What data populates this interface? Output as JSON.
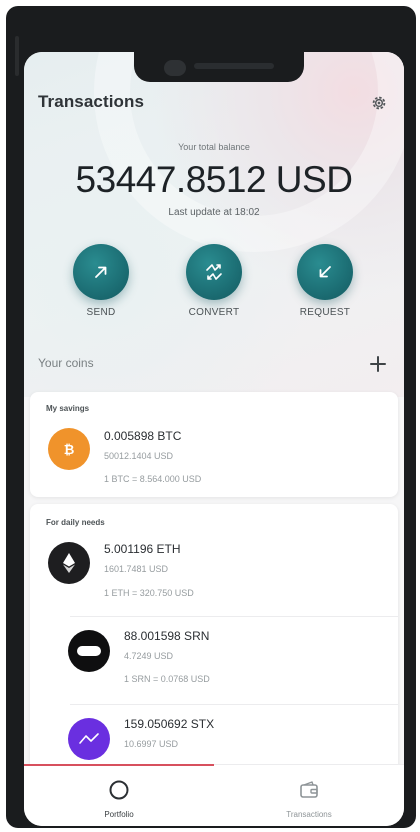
{
  "header": {
    "title": "Transactions",
    "settings_icon": "gear-icon"
  },
  "balance": {
    "caption": "Your total balance",
    "amount": "53447.8512 USD",
    "last_update": "Last update at 18:02"
  },
  "actions": [
    {
      "label": "SEND",
      "icon": "arrow-up-right-icon"
    },
    {
      "label": "CONVERT",
      "icon": "convert-arrows-icon"
    },
    {
      "label": "REQUEST",
      "icon": "arrow-down-left-icon"
    }
  ],
  "coins": {
    "header": "Your coins",
    "add_icon": "plus-icon",
    "groups": [
      {
        "title": "My savings",
        "items": [
          {
            "amount": "0.005898 BTC",
            "fiat": "50012.1404 USD",
            "rate": "1 BTC = 8.564.000 USD",
            "icon": "bitcoin-icon",
            "color": "#f0932b"
          }
        ]
      },
      {
        "title": "For daily needs",
        "items": [
          {
            "amount": "5.001196 ETH",
            "fiat": "1601.7481 USD",
            "rate": "1 ETH = 320.750 USD",
            "icon": "ethereum-icon",
            "color": "#1e1e20"
          },
          {
            "amount": "88.001598 SRN",
            "fiat": "4.7249 USD",
            "rate": "1 SRN = 0.0768 USD",
            "icon": "sirin-icon",
            "color": "#0f0f10"
          },
          {
            "amount": "159.050692 STX",
            "fiat": "10.6997 USD",
            "rate": "",
            "icon": "stox-icon",
            "color": "#6a2fe0"
          }
        ]
      }
    ]
  },
  "tabs": [
    {
      "label": "Portfolio",
      "icon": "portfolio-icon",
      "active": true
    },
    {
      "label": "Transactions",
      "icon": "wallet-icon",
      "active": false
    }
  ],
  "colors": {
    "accent": "#1c6e74",
    "tab_indicator": "#d7505e"
  }
}
